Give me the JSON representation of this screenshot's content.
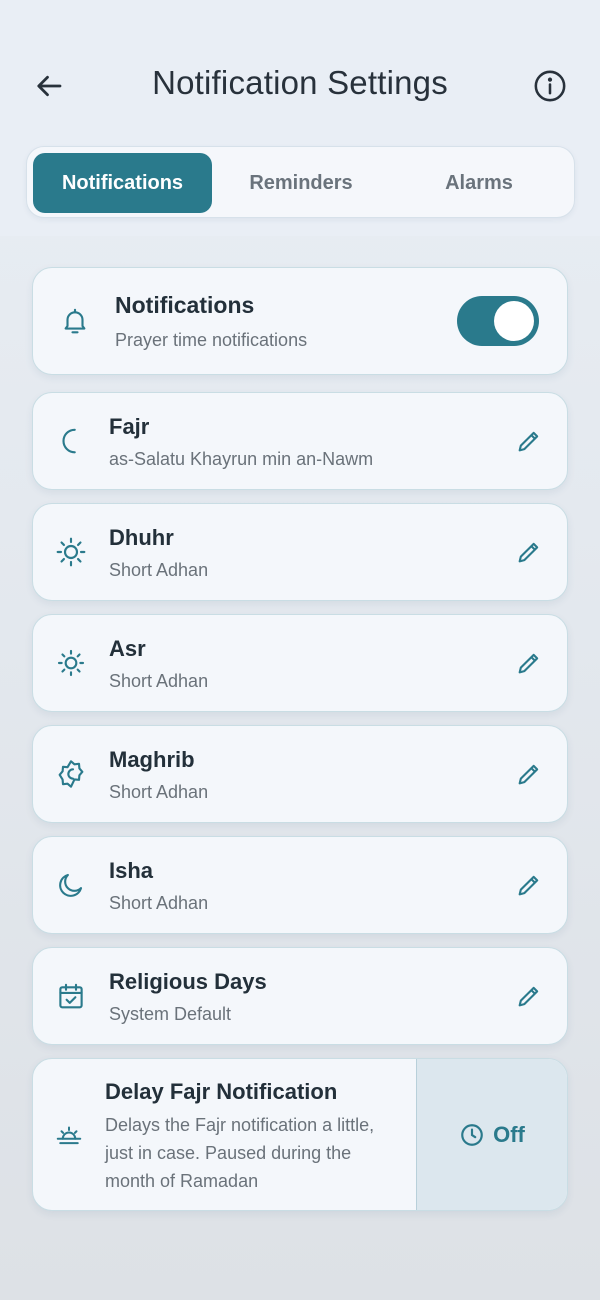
{
  "header": {
    "title": "Notification Settings",
    "back_icon": "arrow-left-icon",
    "info_icon": "info-circle-icon"
  },
  "tabs": [
    {
      "label": "Notifications",
      "active": true
    },
    {
      "label": "Reminders",
      "active": false
    },
    {
      "label": "Alarms",
      "active": false
    }
  ],
  "master": {
    "icon": "bell-icon",
    "title": "Notifications",
    "subtitle": "Prayer time notifications",
    "enabled": true
  },
  "prayers": [
    {
      "icon": "crescent-icon",
      "name": "Fajr",
      "sound": "as-Salatu Khayrun min an-Nawm"
    },
    {
      "icon": "sun-icon",
      "name": "Dhuhr",
      "sound": "Short Adhan"
    },
    {
      "icon": "sun-icon",
      "name": "Asr",
      "sound": "Short Adhan"
    },
    {
      "icon": "sunset-star-icon",
      "name": "Maghrib",
      "sound": "Short Adhan"
    },
    {
      "icon": "moon-icon",
      "name": "Isha",
      "sound": "Short Adhan"
    },
    {
      "icon": "calendar-check-icon",
      "name": "Religious Days",
      "sound": "System Default"
    }
  ],
  "delay": {
    "icon": "sunrise-icon",
    "title": "Delay Fajr Notification",
    "description": "Delays the Fajr notification a little, just in case. Paused during the month of Ramadan",
    "value": "Off",
    "value_icon": "clock-icon"
  },
  "colors": {
    "accent": "#2a7a8c",
    "text": "#23303a",
    "muted": "#6a727a",
    "card_bg": "#f4f7fb",
    "card_border": "#c9dde4"
  }
}
